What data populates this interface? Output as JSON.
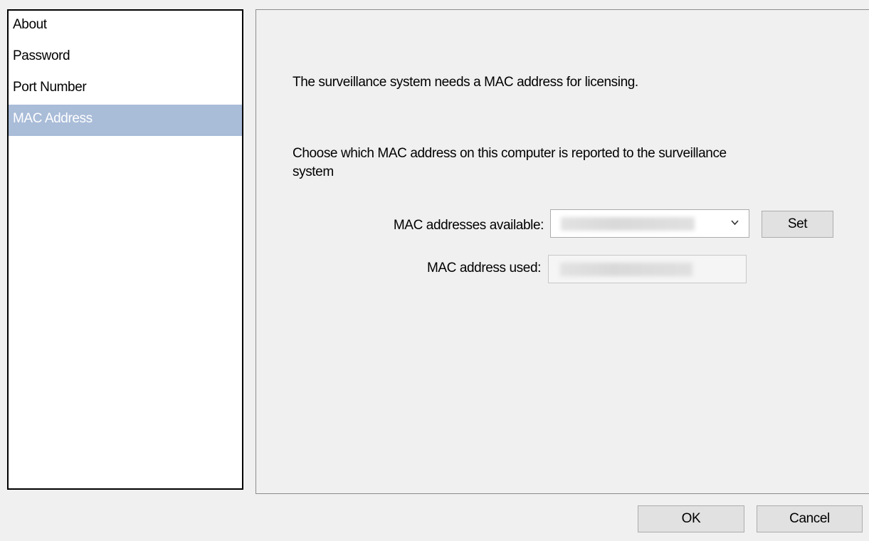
{
  "sidebar": {
    "items": [
      {
        "label": "About",
        "selected": false
      },
      {
        "label": "Password",
        "selected": false
      },
      {
        "label": "Port Number",
        "selected": false
      },
      {
        "label": "MAC Address",
        "selected": true
      }
    ]
  },
  "content": {
    "intro_text": "The surveillance system needs a MAC address for licensing.",
    "choose_text": "Choose which MAC address on this computer is reported to the surveillance system",
    "available_label": "MAC addresses available:",
    "used_label": "MAC address used:",
    "set_label": "Set"
  },
  "footer": {
    "ok_label": "OK",
    "cancel_label": "Cancel"
  },
  "colors": {
    "selection": "#a9bcd8",
    "window_bg": "#f0f0f0"
  },
  "icons": {
    "dropdown": "chevron-down-icon"
  }
}
